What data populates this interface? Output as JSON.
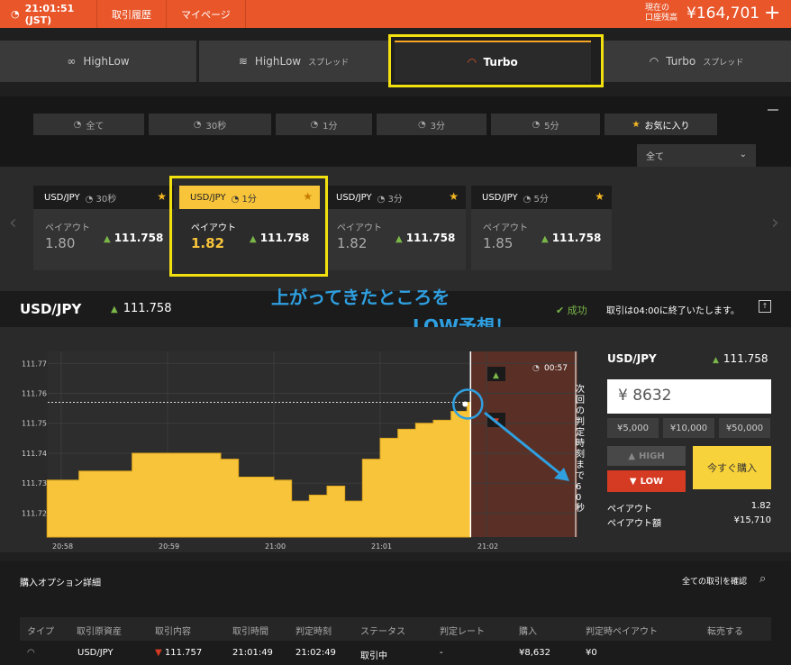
{
  "topbar": {
    "clock": "21:01:51 (JST)",
    "nav": [
      "取引履歴",
      "マイページ"
    ],
    "balance_label_1": "現在の",
    "balance_label_2": "口座残高",
    "balance": "¥164,701"
  },
  "product_tabs": [
    {
      "label": "HighLow",
      "suffix": ""
    },
    {
      "label": "HighLow",
      "suffix": "スプレッド"
    },
    {
      "label": "Turbo",
      "suffix": ""
    },
    {
      "label": "Turbo",
      "suffix": "スプレッド"
    }
  ],
  "filters": [
    "全て",
    "30秒",
    "1分",
    "3分",
    "5分",
    "お気に入り"
  ],
  "dropdown": "全て",
  "cards": [
    {
      "symbol": "USD/JPY",
      "time": "30秒",
      "payout_label": "ペイアウト",
      "payout": "1.80",
      "rate": "111.758"
    },
    {
      "symbol": "USD/JPY",
      "time": "1分",
      "payout_label": "ペイアウト",
      "payout": "1.82",
      "rate": "111.758"
    },
    {
      "symbol": "USD/JPY",
      "time": "3分",
      "payout_label": "ペイアウト",
      "payout": "1.82",
      "rate": "111.758"
    },
    {
      "symbol": "USD/JPY",
      "time": "5分",
      "payout_label": "ペイアウト",
      "payout": "1.85",
      "rate": "111.758"
    }
  ],
  "asset_header": {
    "symbol": "USD/JPY",
    "rate": "111.758",
    "status": "成功",
    "note": "取引は04:00に終了いたします。"
  },
  "annotation": {
    "line1": "上がってきたところを",
    "line2": "LOW予想！"
  },
  "chart_data": {
    "type": "area",
    "x_ticks": [
      "20:58",
      "20:59",
      "21:00",
      "21:01",
      "21:02"
    ],
    "y_ticks": [
      111.77,
      111.76,
      111.75,
      111.74,
      111.73,
      111.72
    ],
    "ylim": [
      111.712,
      111.774
    ],
    "x": [
      "20:57:52",
      "20:58:10",
      "20:58:40",
      "20:59:00",
      "20:59:30",
      "20:59:40",
      "21:00:00",
      "21:00:10",
      "21:00:20",
      "21:00:30",
      "21:00:40",
      "21:00:50",
      "21:01:00",
      "21:01:10",
      "21:01:20",
      "21:01:30",
      "21:01:40",
      "21:01:49",
      "21:01:51"
    ],
    "values": [
      111.731,
      111.734,
      111.74,
      111.74,
      111.738,
      111.732,
      111.731,
      111.724,
      111.726,
      111.729,
      111.724,
      111.738,
      111.745,
      111.748,
      111.75,
      111.751,
      111.754,
      111.757,
      111.758
    ],
    "entry_rate": 111.757,
    "countdown": "00:57",
    "side_label": "次回の判定時刻まで60秒",
    "color": "#f8c43a"
  },
  "panel": {
    "symbol": "USD/JPY",
    "rate": "111.758",
    "amount": "¥ 8632",
    "quick": [
      "¥5,000",
      "¥10,000",
      "¥50,000"
    ],
    "high": "HIGH",
    "low": "LOW",
    "buy": "今すぐ購入",
    "payout_label": "ペイアウト",
    "payout_value": "1.82",
    "payout_amount_label": "ペイアウト額",
    "payout_amount_value": "¥15,710"
  },
  "details": {
    "title": "購入オプション詳細",
    "all_link": "全ての取引を確認",
    "headers": [
      "タイプ",
      "取引原資産",
      "取引内容",
      "取引時間",
      "判定時刻",
      "ステータス",
      "判定レート",
      "購入",
      "判定時ペイアウト",
      "転売する"
    ],
    "row": {
      "asset": "USD/JPY",
      "content": "111.757",
      "time": "21:01:49",
      "judge": "21:02:49",
      "status": "取引中",
      "rate": "-",
      "buy": "¥8,632",
      "payout": "¥0"
    }
  }
}
